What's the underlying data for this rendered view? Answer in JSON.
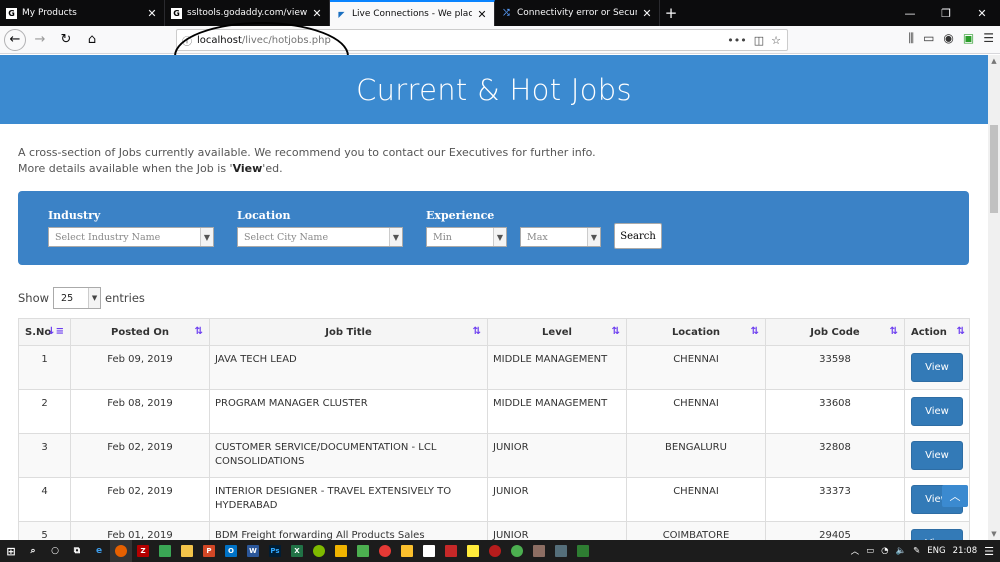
{
  "browser": {
    "tabs": [
      {
        "title": "My Products",
        "favicon": "G",
        "active": false
      },
      {
        "title": "ssltools.godaddy.com/views",
        "favicon": "G",
        "active": false
      },
      {
        "title": "Live Connections - We place Pe",
        "favicon": "LC",
        "active": true
      },
      {
        "title": "Connectivity error or Security C",
        "favicon": "broken",
        "active": false
      }
    ],
    "url_host": "localhost",
    "url_path": "/livec/hotjobs.php",
    "window_controls": {
      "minimize": "—",
      "maximize": "❐",
      "close": "✕"
    }
  },
  "page": {
    "title": "Current & Hot Jobs",
    "intro_line1": "A cross-section of Jobs currently available. We recommend you to contact our Executives for further info.",
    "intro_line2_pre": "More details available when the Job is '",
    "intro_line2_bold": "View",
    "intro_line2_post": "'ed.",
    "filters": {
      "industry_label": "Industry",
      "industry_placeholder": "Select Industry Name",
      "location_label": "Location",
      "location_placeholder": "Select City Name",
      "experience_label": "Experience",
      "min_placeholder": "Min",
      "max_placeholder": "Max",
      "search_label": "Search"
    },
    "show_label": "Show",
    "show_value": "25",
    "entries_label": "entries",
    "table": {
      "headers": [
        "S.No",
        "Posted On",
        "Job Title",
        "Level",
        "Location",
        "Job Code",
        "Action"
      ],
      "rows": [
        {
          "sno": "1",
          "posted": "Feb 09, 2019",
          "title": "JAVA TECH LEAD",
          "level": "MIDDLE MANAGEMENT",
          "location": "CHENNAI",
          "code": "33598",
          "action": "View"
        },
        {
          "sno": "2",
          "posted": "Feb 08, 2019",
          "title": "PROGRAM MANAGER CLUSTER",
          "level": "MIDDLE MANAGEMENT",
          "location": "CHENNAI",
          "code": "33608",
          "action": "View"
        },
        {
          "sno": "3",
          "posted": "Feb 02, 2019",
          "title": "CUSTOMER SERVICE/DOCUMENTATION - LCL CONSOLIDATIONS",
          "level": "JUNIOR",
          "location": "BENGALURU",
          "code": "32808",
          "action": "View"
        },
        {
          "sno": "4",
          "posted": "Feb 02, 2019",
          "title": "INTERIOR DESIGNER - TRAVEL EXTENSIVELY TO HYDERABAD",
          "level": "JUNIOR",
          "location": "CHENNAI",
          "code": "33373",
          "action": "View"
        },
        {
          "sno": "5",
          "posted": "Feb 01, 2019",
          "title": "BDM Freight forwarding All Products Sales",
          "level": "JUNIOR",
          "location": "COIMBATORE",
          "code": "29405",
          "action": "View"
        }
      ]
    }
  },
  "taskbar": {
    "language": "ENG",
    "time": "21:08"
  },
  "colors": {
    "hero": "#3b8ad0",
    "filter_box": "#3b82c6",
    "view_button": "#337ab7",
    "sort_icon": "#6b3cf0"
  }
}
